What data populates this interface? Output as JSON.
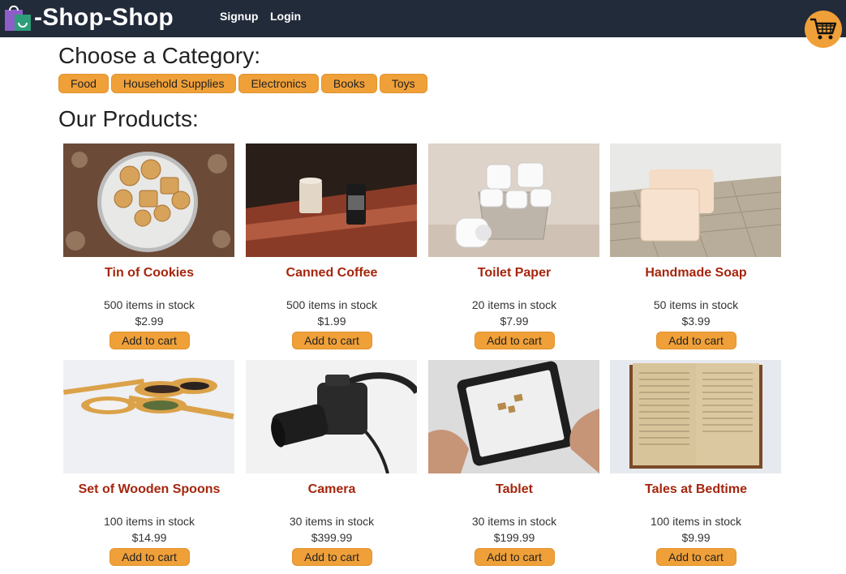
{
  "header": {
    "brand": "-Shop-Shop",
    "nav": [
      "Signup",
      "Login"
    ],
    "colors": {
      "bar": "#222b3a",
      "accent": "#f0a038"
    }
  },
  "categories": {
    "heading": "Choose a Category:",
    "items": [
      "Food",
      "Household Supplies",
      "Electronics",
      "Books",
      "Toys"
    ]
  },
  "products": {
    "heading": "Our Products:",
    "add_label": "Add to cart",
    "items": [
      {
        "name": "Tin of Cookies",
        "stock": "500 items in stock",
        "price": "$2.99"
      },
      {
        "name": "Canned Coffee",
        "stock": "500 items in stock",
        "price": "$1.99"
      },
      {
        "name": "Toilet Paper",
        "stock": "20 items in stock",
        "price": "$7.99"
      },
      {
        "name": "Handmade Soap",
        "stock": "50 items in stock",
        "price": "$3.99"
      },
      {
        "name": "Set of Wooden Spoons",
        "stock": "100 items in stock",
        "price": "$14.99"
      },
      {
        "name": "Camera",
        "stock": "30 items in stock",
        "price": "$399.99"
      },
      {
        "name": "Tablet",
        "stock": "30 items in stock",
        "price": "$199.99"
      },
      {
        "name": "Tales at Bedtime",
        "stock": "100 items in stock",
        "price": "$9.99"
      }
    ]
  }
}
